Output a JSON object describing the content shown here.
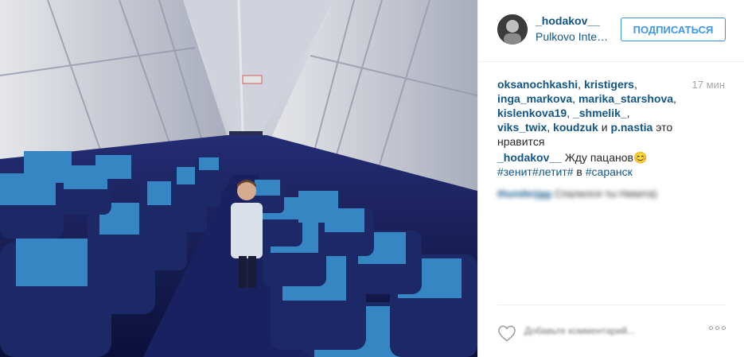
{
  "header": {
    "username": "_hodakov__",
    "location": "Pulkovo International Airport",
    "follow_label": "ПОДПИСАТЬСЯ"
  },
  "likes": {
    "users": [
      "oksanochkashi",
      "kristigers",
      "inga_markova",
      "marika_starshova",
      "kislenkova19",
      "_shmelik_",
      "viks_twix",
      "koudzuk",
      "p.nastia"
    ],
    "sep": ", ",
    "and_word": " и ",
    "suffix": " это нравится"
  },
  "time": "17 мин",
  "caption": {
    "username": "_hodakov__",
    "text": " Жду пацанов",
    "emoji": "😊",
    "tags": [
      "#зенит",
      "#летит#"
    ],
    "in_word": " в ",
    "place_tag": "#саранск"
  },
  "comment": {
    "username": "thunderjgg",
    "text": "Спалился ты Никита)"
  },
  "actions": {
    "comment_placeholder": "Добавьте комментарий...",
    "like_icon": "heart-icon",
    "more_icon": "more-options-icon"
  },
  "colors": {
    "link": "#125688",
    "follow_border": "#4090db",
    "follow_text": "#3897f0",
    "seat_blue": "#2f84c8",
    "seat_dark": "#1a2a6a"
  }
}
